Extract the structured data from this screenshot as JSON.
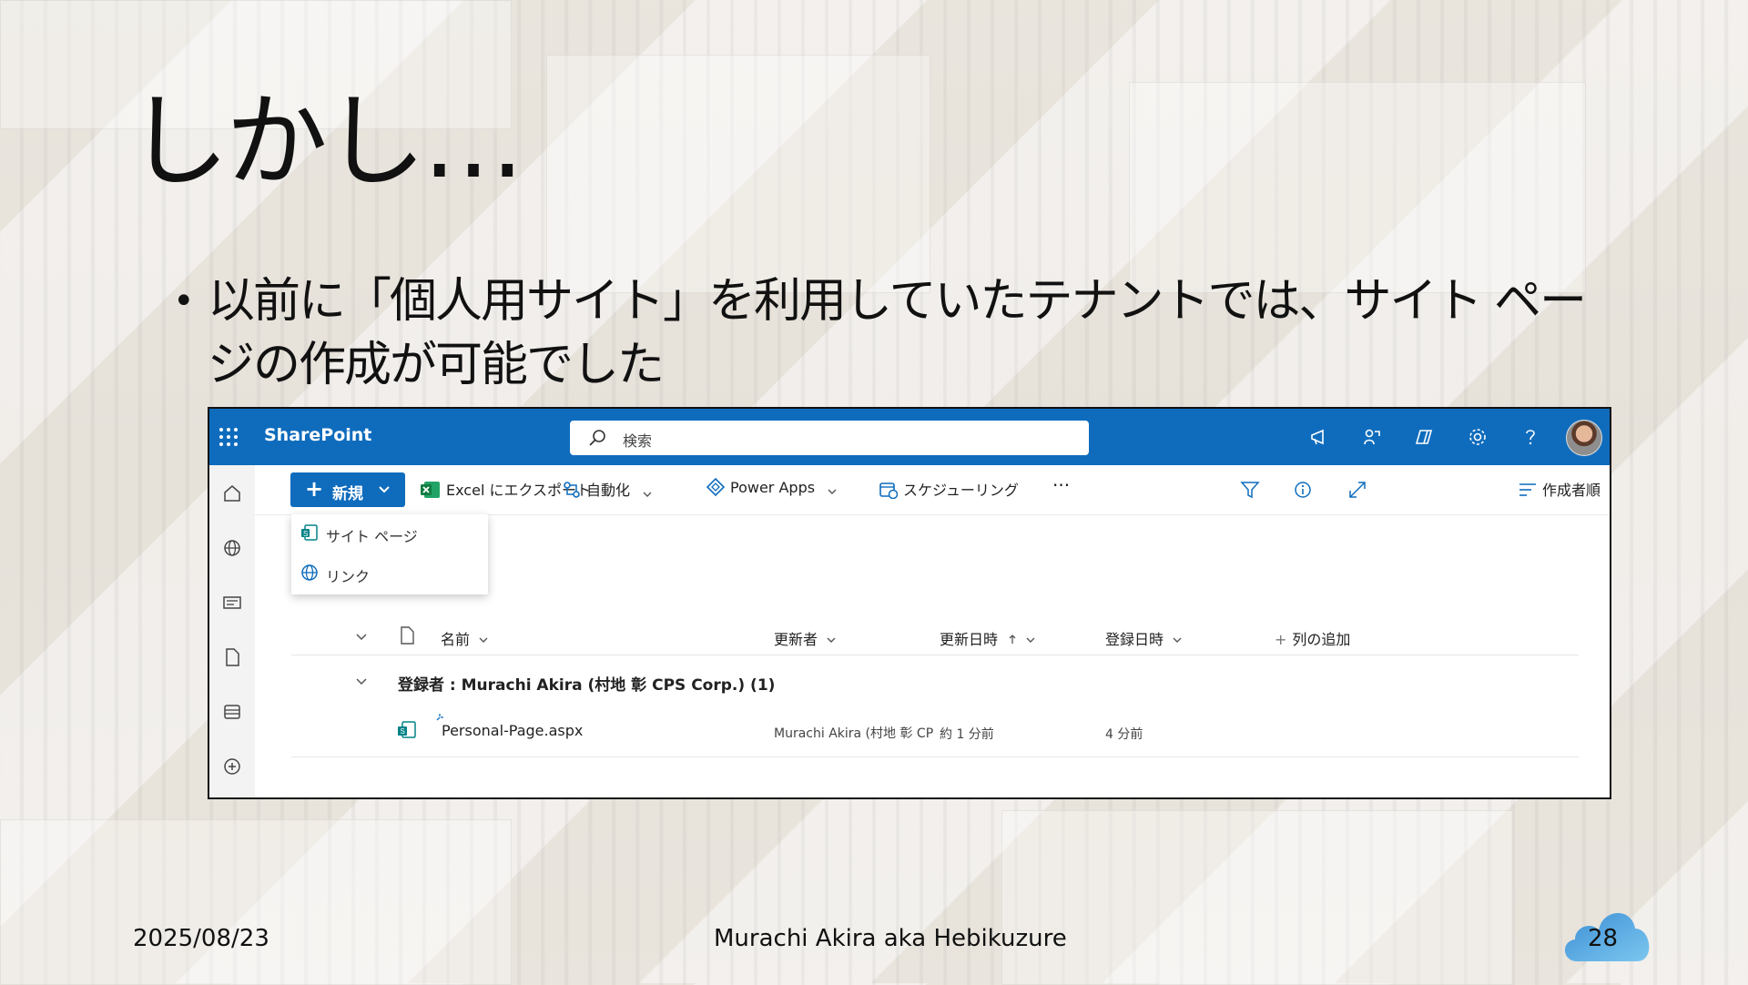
{
  "slide": {
    "title": "しかし…",
    "bullet": "以前に「個人用サイト」を利用していたテナントでは、サイト ページの作成が可能でした",
    "date": "2025/08/23",
    "author": "Murachi Akira aka Hebikuzure",
    "page_number": "28"
  },
  "sharepoint": {
    "brand": "SharePoint",
    "search_placeholder": "検索",
    "command_bar": {
      "new_label": "新規",
      "export_label": "Excel にエクスポート",
      "automate_label": "自動化",
      "powerapps_label": "Power Apps",
      "schedule_label": "スケジューリング",
      "more_label": "···",
      "sort_label": "作成者順"
    },
    "new_menu": {
      "items": [
        "サイト ページ",
        "リンク"
      ]
    },
    "columns": {
      "name": "名前",
      "modified_by": "更新者",
      "modified": "更新日時",
      "created": "登録日時",
      "add_column": "列の追加"
    },
    "group_header": "登録者 : Murachi Akira (村地 彰 CPS Corp.) (1)",
    "rows": [
      {
        "name": "Personal-Page.aspx",
        "modified_by": "Murachi Akira (村地 彰 CP",
        "modified": "約 1 分前",
        "created": "4 分前"
      }
    ]
  },
  "colors": {
    "brand_blue": "#0f6cbd",
    "rail_bg": "#f3f3f3"
  }
}
